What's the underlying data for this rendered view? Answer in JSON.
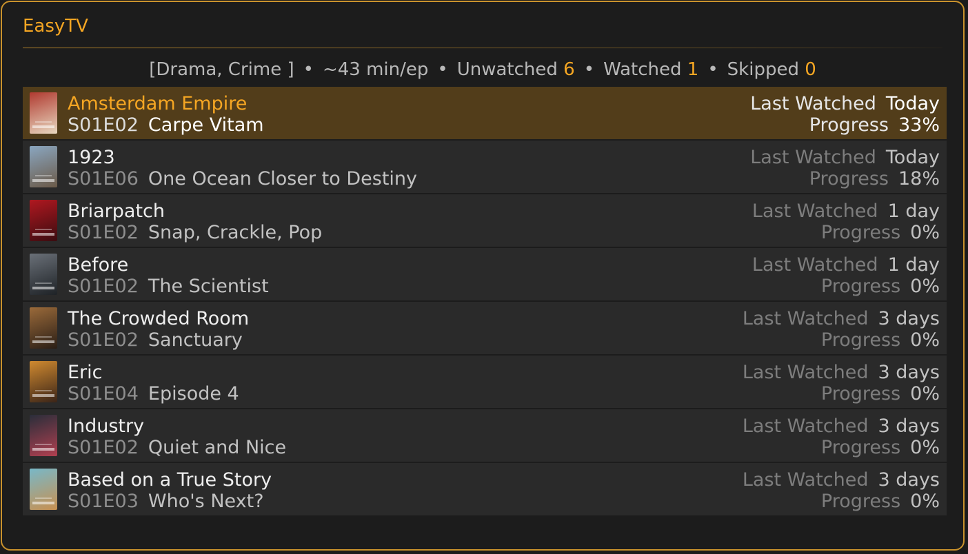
{
  "app": {
    "title": "EasyTV"
  },
  "summary": {
    "genres": "[Drama, Crime ]",
    "runtime": "~43 min/ep",
    "bullet": "•",
    "unwatched_label": "Unwatched",
    "unwatched_value": "6",
    "watched_label": "Watched",
    "watched_value": "1",
    "skipped_label": "Skipped",
    "skipped_value": "0"
  },
  "labels": {
    "last_watched": "Last Watched",
    "progress": "Progress"
  },
  "colors": {
    "accent": "#f5a623",
    "selected_row": "#523d1a",
    "row": "#2a2a2a",
    "border": "#c9922c"
  },
  "shows": [
    {
      "title": "Amsterdam Empire",
      "episode": "S01E02",
      "episode_title": "Carpe Vitam",
      "last_watched": "Today",
      "progress": "33%",
      "selected": true,
      "poster_colors": [
        "#b03a30",
        "#e8d8c0"
      ]
    },
    {
      "title": "1923",
      "episode": "S01E06",
      "episode_title": "One Ocean Closer to Destiny",
      "last_watched": "Today",
      "progress": "18%",
      "selected": false,
      "poster_colors": [
        "#8aa6c0",
        "#6b5a48"
      ]
    },
    {
      "title": "Briarpatch",
      "episode": "S01E02",
      "episode_title": "Snap, Crackle, Pop",
      "last_watched": "1 day",
      "progress": "0%",
      "selected": false,
      "poster_colors": [
        "#b01820",
        "#3a0c10"
      ]
    },
    {
      "title": "Before",
      "episode": "S01E02",
      "episode_title": "The Scientist",
      "last_watched": "1 day",
      "progress": "0%",
      "selected": false,
      "poster_colors": [
        "#6a7078",
        "#1e2226"
      ]
    },
    {
      "title": "The Crowded Room",
      "episode": "S01E02",
      "episode_title": "Sanctuary",
      "last_watched": "3 days",
      "progress": "0%",
      "selected": false,
      "poster_colors": [
        "#9a6a3a",
        "#2a1e16"
      ]
    },
    {
      "title": "Eric",
      "episode": "S01E04",
      "episode_title": "Episode 4",
      "last_watched": "3 days",
      "progress": "0%",
      "selected": false,
      "poster_colors": [
        "#d08a30",
        "#3a2418"
      ]
    },
    {
      "title": "Industry",
      "episode": "S01E02",
      "episode_title": "Quiet and Nice",
      "last_watched": "3 days",
      "progress": "0%",
      "selected": false,
      "poster_colors": [
        "#2a2e3a",
        "#b04050"
      ]
    },
    {
      "title": "Based on a True Story",
      "episode": "S01E03",
      "episode_title": "Who's Next?",
      "last_watched": "3 days",
      "progress": "0%",
      "selected": false,
      "poster_colors": [
        "#78b8c8",
        "#c89050"
      ]
    }
  ]
}
